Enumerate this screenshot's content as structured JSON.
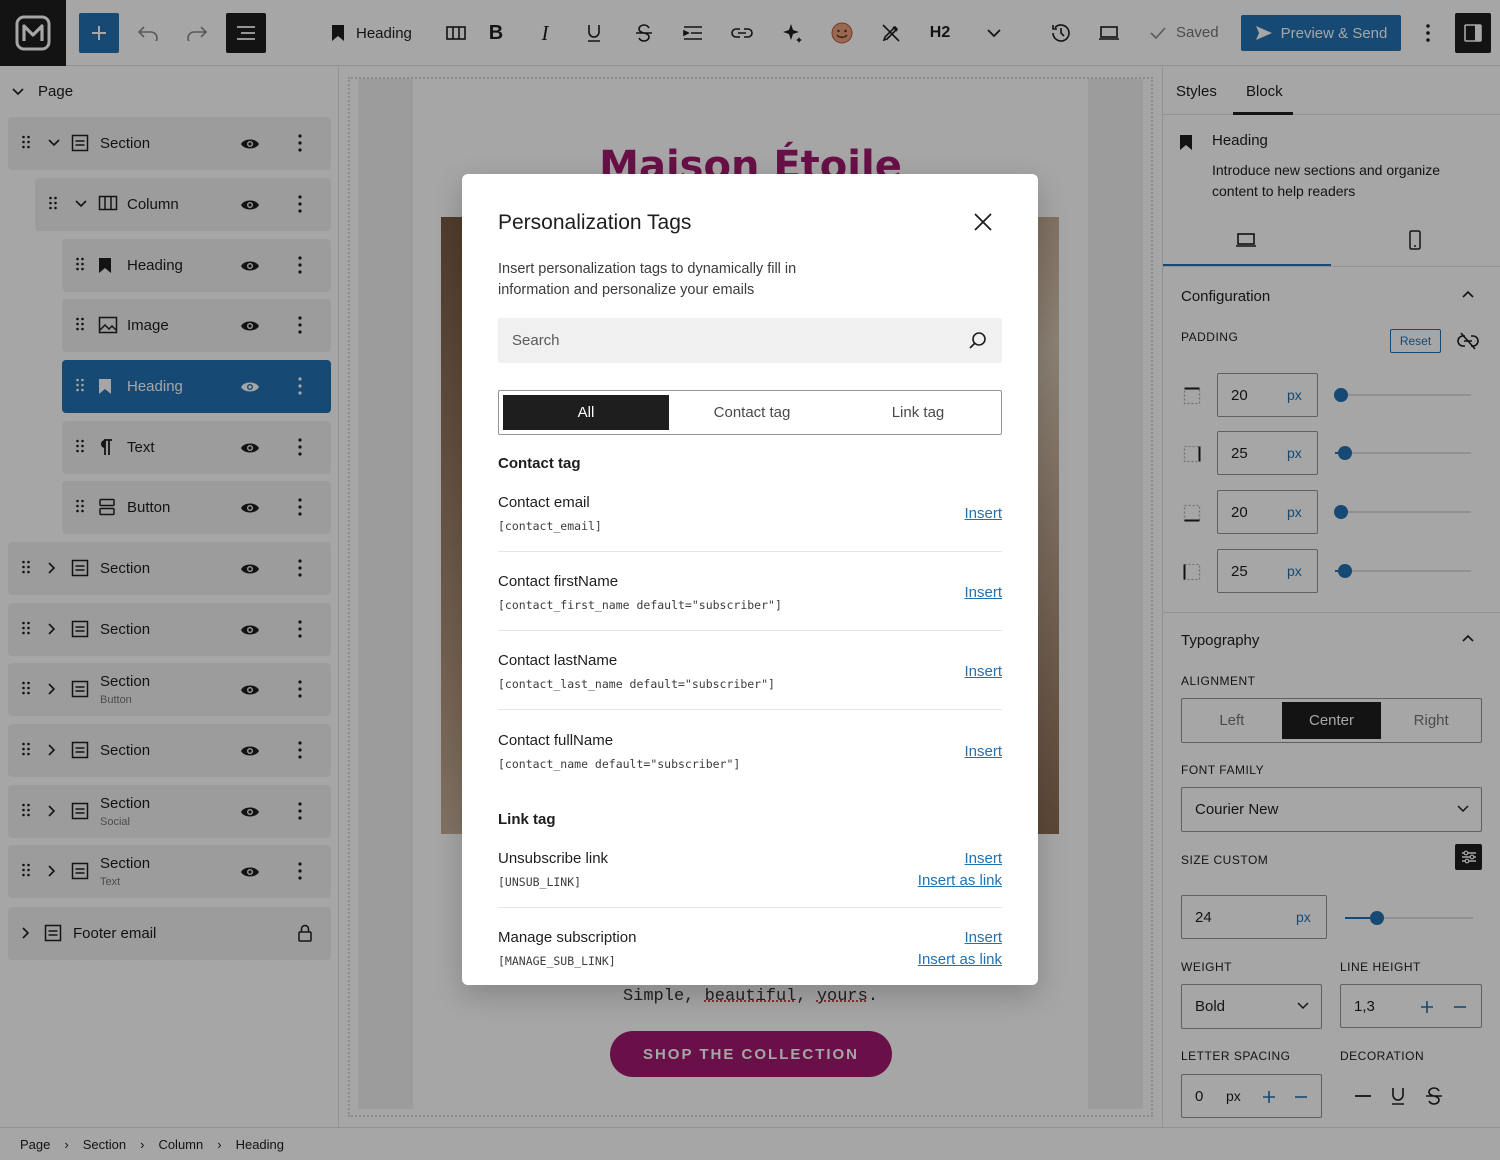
{
  "toolbar": {
    "block_type": "Heading",
    "heading_level": "H2",
    "saved": "Saved",
    "preview": "Preview & Send"
  },
  "sidebar": {
    "page": "Page",
    "items": [
      {
        "label": "Section",
        "sub": ""
      },
      {
        "label": "Column",
        "sub": ""
      },
      {
        "label": "Heading",
        "sub": ""
      },
      {
        "label": "Image",
        "sub": ""
      },
      {
        "label": "Heading",
        "sub": ""
      },
      {
        "label": "Text",
        "sub": ""
      },
      {
        "label": "Button",
        "sub": ""
      },
      {
        "label": "Section",
        "sub": ""
      },
      {
        "label": "Section",
        "sub": ""
      },
      {
        "label": "Section",
        "sub": "Button"
      },
      {
        "label": "Section",
        "sub": ""
      },
      {
        "label": "Section",
        "sub": "Social"
      },
      {
        "label": "Section",
        "sub": "Text"
      },
      {
        "label": "Footer email",
        "sub": ""
      }
    ]
  },
  "canvas": {
    "brand": "Maison Étoile",
    "tagline_pre": "Simple, ",
    "tagline_w1": "beautiful",
    "tagline_mid": ", ",
    "tagline_w2": "yours",
    "tagline_post": ".",
    "cta": "SHOP THE COLLECTION"
  },
  "panel": {
    "tabs": [
      "Styles",
      "Block"
    ],
    "block_title": "Heading",
    "block_desc": "Introduce new sections and organize content to help readers",
    "configuration": "Configuration",
    "padding_label": "PADDING",
    "reset": "Reset",
    "padding": [
      {
        "value": "20",
        "unit": "px",
        "level": 0.0
      },
      {
        "value": "25",
        "unit": "px",
        "level": 0.03
      },
      {
        "value": "20",
        "unit": "px",
        "level": 0.0
      },
      {
        "value": "25",
        "unit": "px",
        "level": 0.03
      }
    ],
    "typography": "Typography",
    "alignment_label": "ALIGNMENT",
    "alignment": [
      "Left",
      "Center",
      "Right"
    ],
    "font_family_label": "FONT FAMILY",
    "font_family": "Courier New",
    "size_label": "SIZE CUSTOM",
    "size_value": "24",
    "size_unit": "px",
    "weight_label": "WEIGHT",
    "weight": "Bold",
    "line_height_label": "LINE HEIGHT",
    "line_height": "1,3",
    "letter_spacing_label": "LETTER SPACING",
    "letter_spacing": "0",
    "letter_spacing_unit": "px",
    "decoration_label": "DECORATION"
  },
  "breadcrumb": [
    "Page",
    "Section",
    "Column",
    "Heading"
  ],
  "modal": {
    "title": "Personalization Tags",
    "description": "Insert personalization tags to dynamically fill in information and personalize your emails",
    "search_placeholder": "Search",
    "tabs": [
      "All",
      "Contact tag",
      "Link tag"
    ],
    "group_contact": "Contact tag",
    "group_link": "Link tag",
    "insert": "Insert",
    "insert_as_link": "Insert as link",
    "contact_tags": [
      {
        "name": "Contact email",
        "code": "[contact_email]"
      },
      {
        "name": "Contact firstName",
        "code": "[contact_first_name default=\"subscriber\"]"
      },
      {
        "name": "Contact lastName",
        "code": "[contact_last_name default=\"subscriber\"]"
      },
      {
        "name": "Contact fullName",
        "code": "[contact_name default=\"subscriber\"]"
      }
    ],
    "link_tags": [
      {
        "name": "Unsubscribe link",
        "code": "[UNSUB_LINK]"
      },
      {
        "name": "Manage subscription",
        "code": "[MANAGE_SUB_LINK]"
      }
    ]
  },
  "colors": {
    "accent": "#2271b1",
    "brand": "#a0196d",
    "dark": "#1e1e1e"
  }
}
